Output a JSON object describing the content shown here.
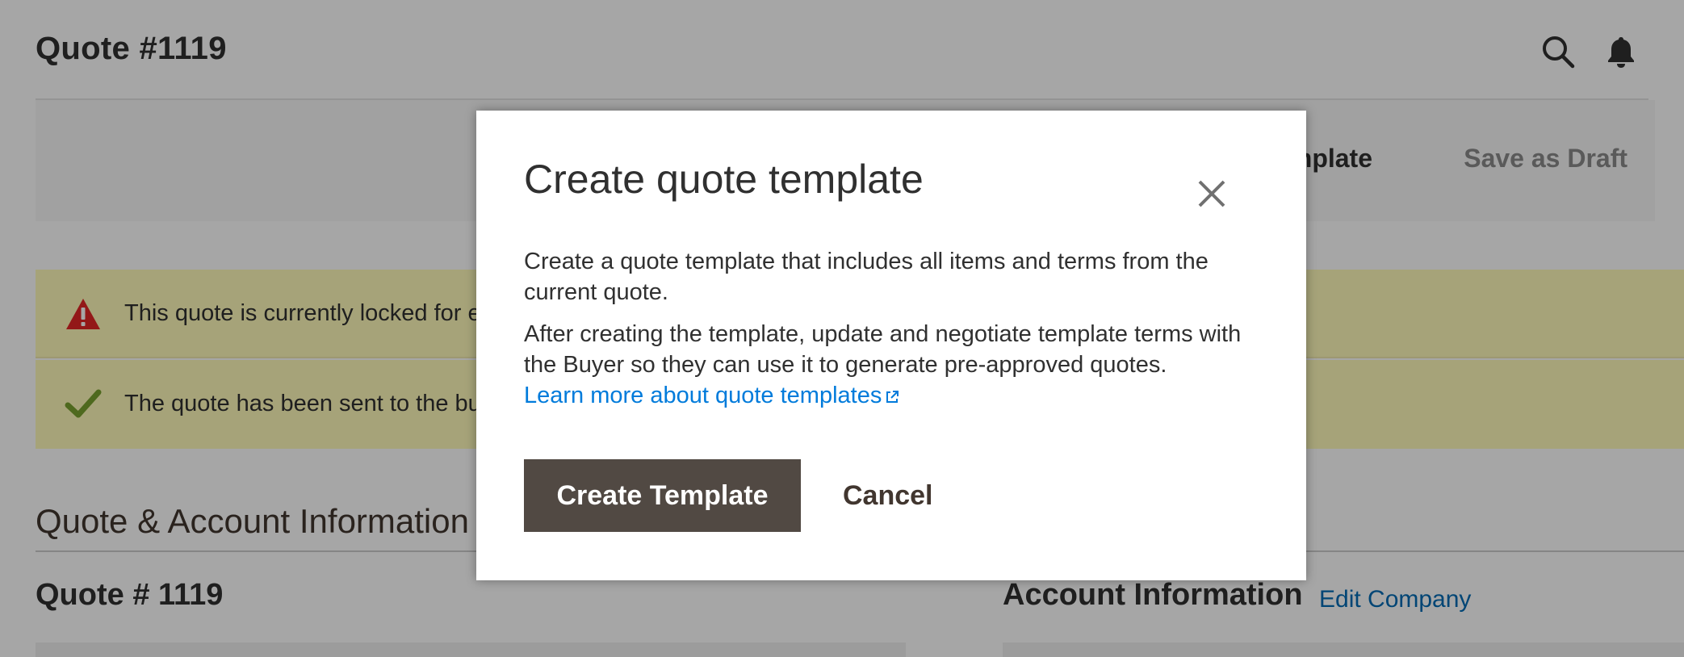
{
  "header": {
    "title": "Quote #1119",
    "icons": [
      "search-icon",
      "bell-icon"
    ]
  },
  "actions": {
    "create_template_visible": "mplate",
    "save_draft": "Save as Draft"
  },
  "messages": [
    {
      "type": "warning",
      "icon": "warning-icon",
      "text": "This quote is currently locked for e"
    },
    {
      "type": "success",
      "icon": "checkmark-icon",
      "text": "The quote has been sent to the bu"
    }
  ],
  "section": {
    "title": "Quote & Account Information"
  },
  "blocks": {
    "quote_title": "Quote # 1119",
    "account_title": "Account Information",
    "edit_company": "Edit Company"
  },
  "modal": {
    "title": "Create quote template",
    "paragraph1": "Create a quote template that includes all items and terms from the current quote.",
    "paragraph2": "After creating the template, update and negotiate template terms with the Buyer so they can use it to generate pre-approved quotes.",
    "learn_more": "Learn more about quote templates",
    "primary_button": "Create Template",
    "cancel_button": "Cancel"
  },
  "colors": {
    "primary_button_bg": "#514943",
    "link": "#007bdb",
    "message_bg": "#fffbbb",
    "warning_icon": "#e22626",
    "success_icon": "#79a22e"
  }
}
